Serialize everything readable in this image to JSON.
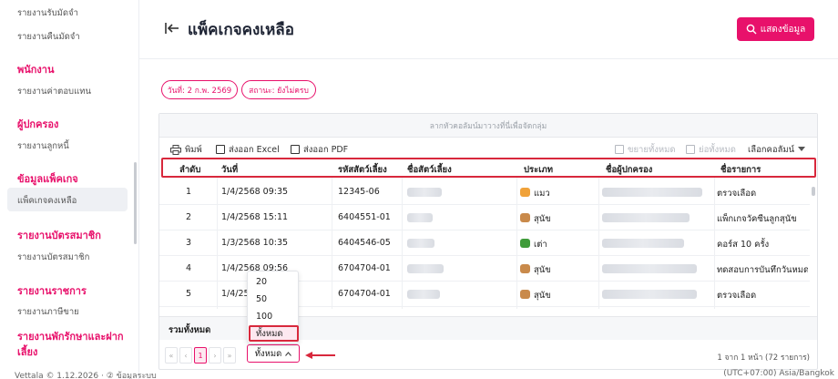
{
  "sidebar": {
    "items_top": [
      "รายงานรับมัดจำ",
      "รายงานคืนมัดจำ"
    ],
    "sections": [
      {
        "title": "พนักงาน",
        "items": [
          "รายงานค่าตอบแทน"
        ]
      },
      {
        "title": "ผู้ปกครอง",
        "items": [
          "รายงานลูกหนี้"
        ]
      },
      {
        "title": "ข้อมูลแพ็คเกจ",
        "items": [
          "แพ็คเกจคงเหลือ"
        ]
      },
      {
        "title": "รายงานบัตรสมาชิก",
        "items": [
          "รายงานบัตรสมาชิก"
        ]
      },
      {
        "title": "รายงานราชการ",
        "items": [
          "รายงานภาษีขาย"
        ]
      },
      {
        "title": "รายงานพักรักษาและฝากเลี้ยง",
        "items": []
      }
    ],
    "footer": "Vettala © 1.12.2026 · ② ข้อมูลระบบ"
  },
  "header": {
    "title": "แพ็คเกจคงเหลือ",
    "show_button": "แสดงข้อมูล"
  },
  "filters": {
    "date_chip": "วันที่: 2 ก.พ. 2569",
    "status_chip": "สถานะ: ยังไม่ครบ"
  },
  "table": {
    "group_hint": "ลากหัวคอลัมน์มาวางที่นี่เพื่อจัดกลุ่ม",
    "toolbar": {
      "print": "พิมพ์",
      "export_excel": "ส่งออก Excel",
      "export_pdf": "ส่งออก PDF",
      "expand_all": "ขยายทั้งหมด",
      "collapse_all": "ย่อทั้งหมด",
      "choose_columns": "เลือกคอลัมน์"
    },
    "columns": [
      "ลำดับ",
      "วันที่",
      "รหัสสัตว์เลี้ยง",
      "ชื่อสัตว์เลี้ยง",
      "ประเภท",
      "ชื่อผู้ปกครอง",
      "ชื่อรายการ"
    ],
    "rows": [
      {
        "no": "1",
        "date": "1/4/2568 09:35",
        "pet_code": "12345-06",
        "type": "แมว",
        "type_color": "#f0a23a",
        "item": "ตรวจเลือด"
      },
      {
        "no": "2",
        "date": "1/4/2568 15:11",
        "pet_code": "6404551-01",
        "type": "สุนัข",
        "type_color": "#c98a4b",
        "item": "แพ็กเกจวัคซีนลูกสุนัข"
      },
      {
        "no": "3",
        "date": "1/3/2568 10:35",
        "pet_code": "6404546-05",
        "type": "เต่า",
        "type_color": "#3f9b3a",
        "item": "คอร์ส 10 ครั้ง"
      },
      {
        "no": "4",
        "date": "1/4/2568 09:56",
        "pet_code": "6704704-01",
        "type": "สุนัข",
        "type_color": "#c98a4b",
        "item": "ทดสอบการบันทึกวันหมดอายุ"
      },
      {
        "no": "5",
        "date": "1/4/256",
        "pet_code": "6704704-01",
        "type": "สุนัข",
        "type_color": "#c98a4b",
        "item": "ตรวจเลือด"
      }
    ],
    "total_label": "รวมทั้งหมด",
    "pager": {
      "first": "«",
      "prev": "‹",
      "page": "1",
      "next": "›",
      "last": "»"
    },
    "page_size_selected": "ทั้งหมด",
    "page_size_options": [
      "20",
      "50",
      "100",
      "ทั้งหมด"
    ],
    "count_text": "1 จาก 1 หน้า (72 รายการ)",
    "timezone": "(UTC+07:00) Asia/Bangkok"
  }
}
